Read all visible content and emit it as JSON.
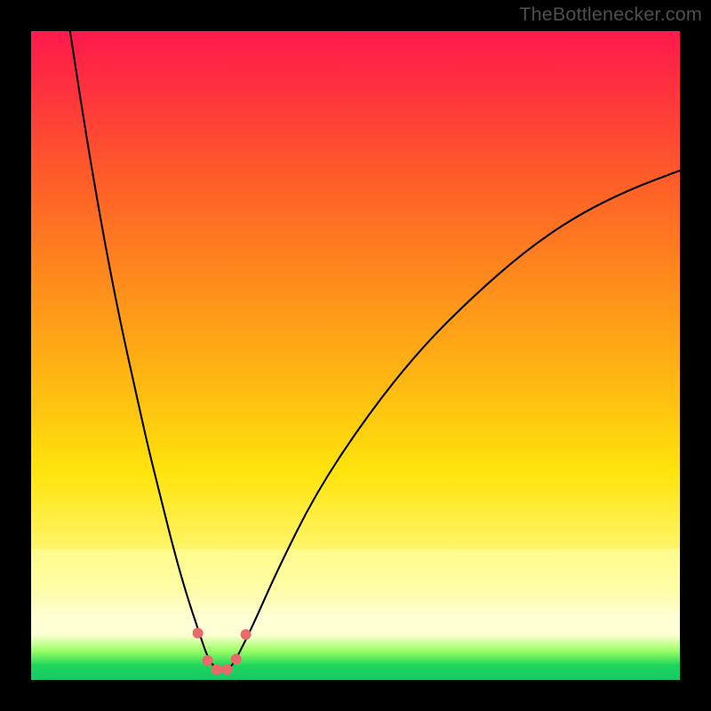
{
  "watermark": "TheBottlenecker.com",
  "chart_data": {
    "type": "line",
    "title": "",
    "xlabel": "",
    "ylabel": "",
    "xlim": [
      0,
      100
    ],
    "ylim": [
      0,
      100
    ],
    "series": [
      {
        "name": "bottleneck-curve",
        "x": [
          6,
          8,
          10,
          12,
          14,
          16,
          18,
          20,
          22,
          24,
          26,
          27,
          28,
          29,
          30,
          31,
          32,
          34,
          38,
          44,
          52,
          60,
          68,
          76,
          84,
          92,
          100
        ],
        "y": [
          100,
          87,
          75,
          64,
          54,
          45,
          36,
          28,
          20,
          13,
          7,
          4,
          2.2,
          1.5,
          1.5,
          2.2,
          4,
          8,
          17,
          29,
          41,
          51,
          59,
          66,
          71.5,
          75.5,
          78.5
        ]
      }
    ],
    "markers": {
      "name": "valley-dots",
      "color_hex": "#e96a6a",
      "points": [
        {
          "x": 25.7,
          "y": 7.2
        },
        {
          "x": 27.2,
          "y": 3.0
        },
        {
          "x": 28.6,
          "y": 1.6
        },
        {
          "x": 30.2,
          "y": 1.6
        },
        {
          "x": 31.6,
          "y": 3.2
        },
        {
          "x": 33.1,
          "y": 7.0
        }
      ]
    },
    "gradient_stops": [
      {
        "pos": 0.0,
        "color": "#ff1a4d"
      },
      {
        "pos": 0.38,
        "color": "#ff8a1c"
      },
      {
        "pos": 0.68,
        "color": "#ffe40c"
      },
      {
        "pos": 0.91,
        "color": "#ffffd5"
      },
      {
        "pos": 0.98,
        "color": "#18c86a"
      }
    ]
  }
}
